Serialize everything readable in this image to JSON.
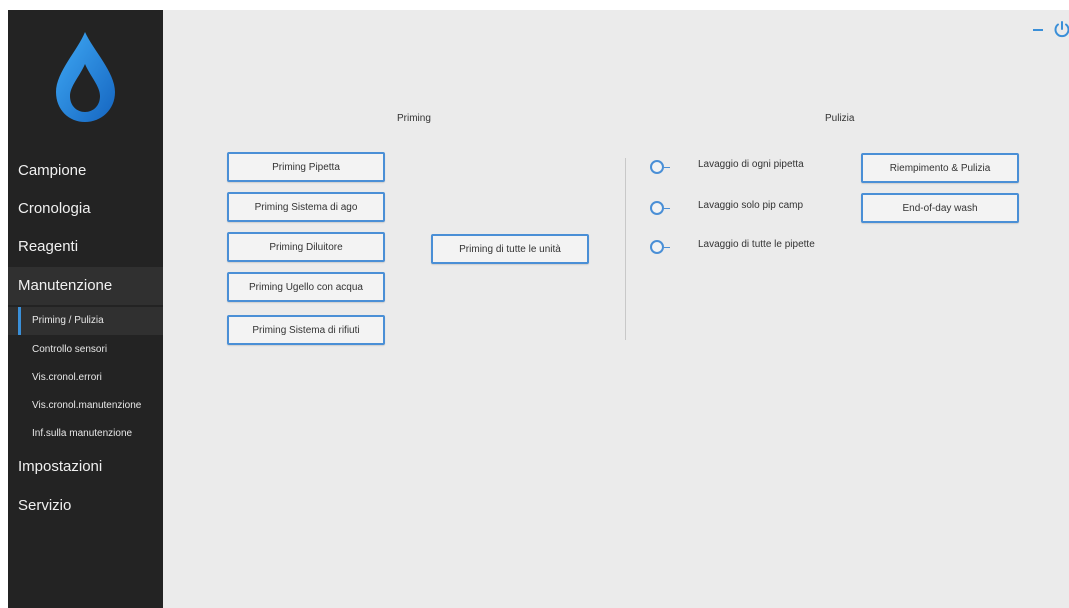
{
  "sidebar": {
    "nav": [
      {
        "label": "Campione"
      },
      {
        "label": "Cronologia"
      },
      {
        "label": "Reagenti"
      },
      {
        "label": "Manutenzione"
      },
      {
        "label": "Impostazioni"
      },
      {
        "label": "Servizio"
      }
    ],
    "submenu": [
      {
        "label": "Priming / Pulizia"
      },
      {
        "label": "Controllo sensori"
      },
      {
        "label": "Vis.cronol.errori"
      },
      {
        "label": "Vis.cronol.manutenzione"
      },
      {
        "label": "Inf.sulla manutenzione"
      }
    ]
  },
  "priming": {
    "title": "Priming",
    "buttons": [
      "Priming Pipetta",
      "Priming Sistema di ago",
      "Priming Diluitore",
      "Priming Ugello con acqua",
      "Priming Sistema di rifiuti"
    ],
    "all_units_button": "Priming di tutte le unità"
  },
  "pulizia": {
    "title": "Pulizia",
    "options": [
      "Lavaggio di ogni pipetta",
      "Lavaggio solo pip camp",
      "Lavaggio di tutte le pipette"
    ],
    "buttons": [
      "Riempimento & Pulizia",
      "End-of-day wash"
    ]
  },
  "colors": {
    "accent": "#4a8fd6",
    "sidebar_bg": "#232323",
    "main_bg": "#ebebeb"
  },
  "icons": {
    "logo": "water-drop-icon",
    "minimize": "minimize-icon",
    "power": "power-icon"
  }
}
